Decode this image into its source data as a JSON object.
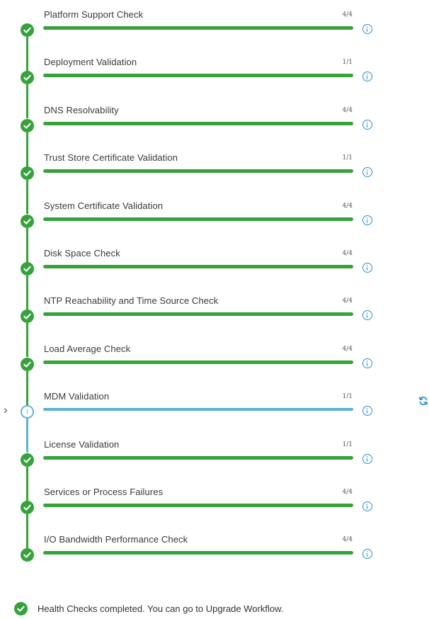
{
  "checks": [
    {
      "name": "Platform Support Check",
      "count": "4/4",
      "status": "done"
    },
    {
      "name": "Deployment Validation",
      "count": "1/1",
      "status": "done"
    },
    {
      "name": "DNS Resolvability",
      "count": "4/4",
      "status": "done"
    },
    {
      "name": "Trust Store Certificate Validation",
      "count": "1/1",
      "status": "done"
    },
    {
      "name": "System Certificate Validation",
      "count": "4/4",
      "status": "done"
    },
    {
      "name": "Disk Space Check",
      "count": "4/4",
      "status": "done"
    },
    {
      "name": "NTP Reachability and Time Source Check",
      "count": "4/4",
      "status": "done"
    },
    {
      "name": "Load Average Check",
      "count": "4/4",
      "status": "done"
    },
    {
      "name": "MDM Validation",
      "count": "1/1",
      "status": "active"
    },
    {
      "name": "License Validation",
      "count": "1/1",
      "status": "done"
    },
    {
      "name": "Services or Process Failures",
      "count": "4/4",
      "status": "done"
    },
    {
      "name": "I/O Bandwidth Performance Check",
      "count": "4/4",
      "status": "done"
    }
  ],
  "summary": {
    "message": "Health Checks completed. You can go to Upgrade Workflow."
  },
  "icons": {
    "step_done": "check-circle-icon",
    "step_active": "in-progress-info-icon",
    "info": "info-icon",
    "expand": "chevron-right-icon",
    "refresh": "refresh-icon"
  },
  "colors": {
    "success": "#35a23a",
    "in_progress": "#59b3d8",
    "info": "#2d8fc9"
  }
}
